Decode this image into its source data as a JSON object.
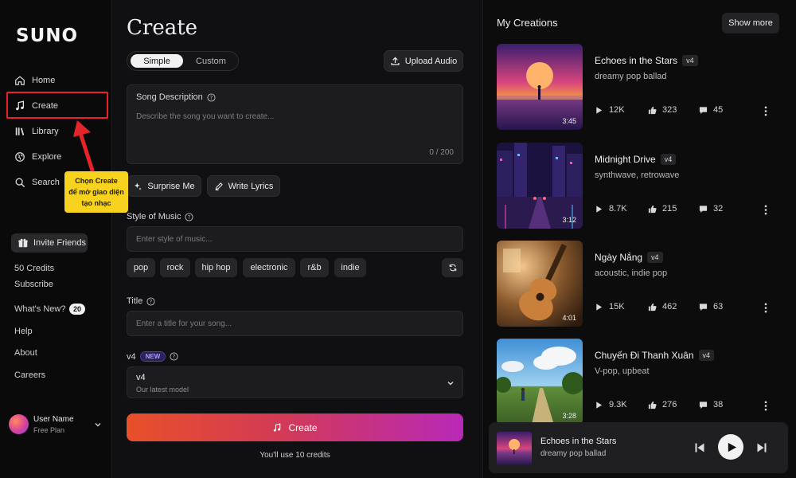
{
  "sidebar": {
    "logo": "SUNO",
    "nav": [
      {
        "label": "Home",
        "icon": "home-icon"
      },
      {
        "label": "Create",
        "icon": "music-note-icon"
      },
      {
        "label": "Library",
        "icon": "library-icon"
      },
      {
        "label": "Explore",
        "icon": "globe-icon"
      },
      {
        "label": "Search",
        "icon": "search-icon"
      }
    ],
    "invite_label": "Invite Friends",
    "credits": "50 Credits",
    "subscribe": "Subscribe",
    "whats_new": "What's New?",
    "whats_new_count": "20",
    "help": "Help",
    "about": "About",
    "careers": "Careers",
    "user": {
      "name": "User Name",
      "plan": "Free Plan"
    }
  },
  "annotation": {
    "lines": [
      "Chọn Create",
      "để mở giao diện",
      "tạo nhạc"
    ],
    "highlight_color": "#e5242a",
    "tooltip_color": "#f7d21e"
  },
  "create": {
    "title": "Create",
    "mode_tabs": [
      "Simple",
      "Custom"
    ],
    "active_mode": "Simple",
    "upload_label": "Upload Audio",
    "song_description": {
      "label": "Song Description",
      "placeholder": "Describe the song you want to create...",
      "counter": "0 / 200"
    },
    "surprise_label": "Surprise Me",
    "write_lyrics_label": "Write Lyrics",
    "style": {
      "label": "Style of Music",
      "placeholder": "Enter style of music...",
      "chips": [
        "pop",
        "rock",
        "hip hop",
        "electronic",
        "r&b",
        "indie"
      ]
    },
    "title_field": {
      "label": "Title",
      "placeholder": "Enter a title for your song..."
    },
    "model": {
      "label": "v4",
      "badge": "NEW",
      "selected": "v4",
      "description": "Our latest model"
    },
    "create_button": "Create",
    "credits_note": "You'll use 10 credits",
    "accent_gradient": [
      "#e8502a",
      "#d33a55",
      "#b829b8"
    ]
  },
  "creations": {
    "title": "My Creations",
    "show_more": "Show more",
    "songs": [
      {
        "title": "Echoes in the Stars",
        "version": "v4",
        "style": "dreamy pop ballad",
        "duration": "3:45",
        "plays": "12K",
        "likes": "323",
        "comments": "45"
      },
      {
        "title": "Midnight Drive",
        "version": "v4",
        "style": "synthwave, retrowave",
        "duration": "3:12",
        "plays": "8.7K",
        "likes": "215",
        "comments": "32"
      },
      {
        "title": "Ngày Nắng",
        "version": "v4",
        "style": "acoustic, indie pop",
        "duration": "4:01",
        "plays": "15K",
        "likes": "462",
        "comments": "63"
      },
      {
        "title": "Chuyến Đi Thanh Xuân",
        "version": "v4",
        "style": "V-pop, upbeat",
        "duration": "3:28",
        "plays": "9.3K",
        "likes": "276",
        "comments": "38"
      }
    ]
  },
  "player": {
    "title": "Echoes in the Stars",
    "subtitle": "dreamy pop ballad"
  }
}
